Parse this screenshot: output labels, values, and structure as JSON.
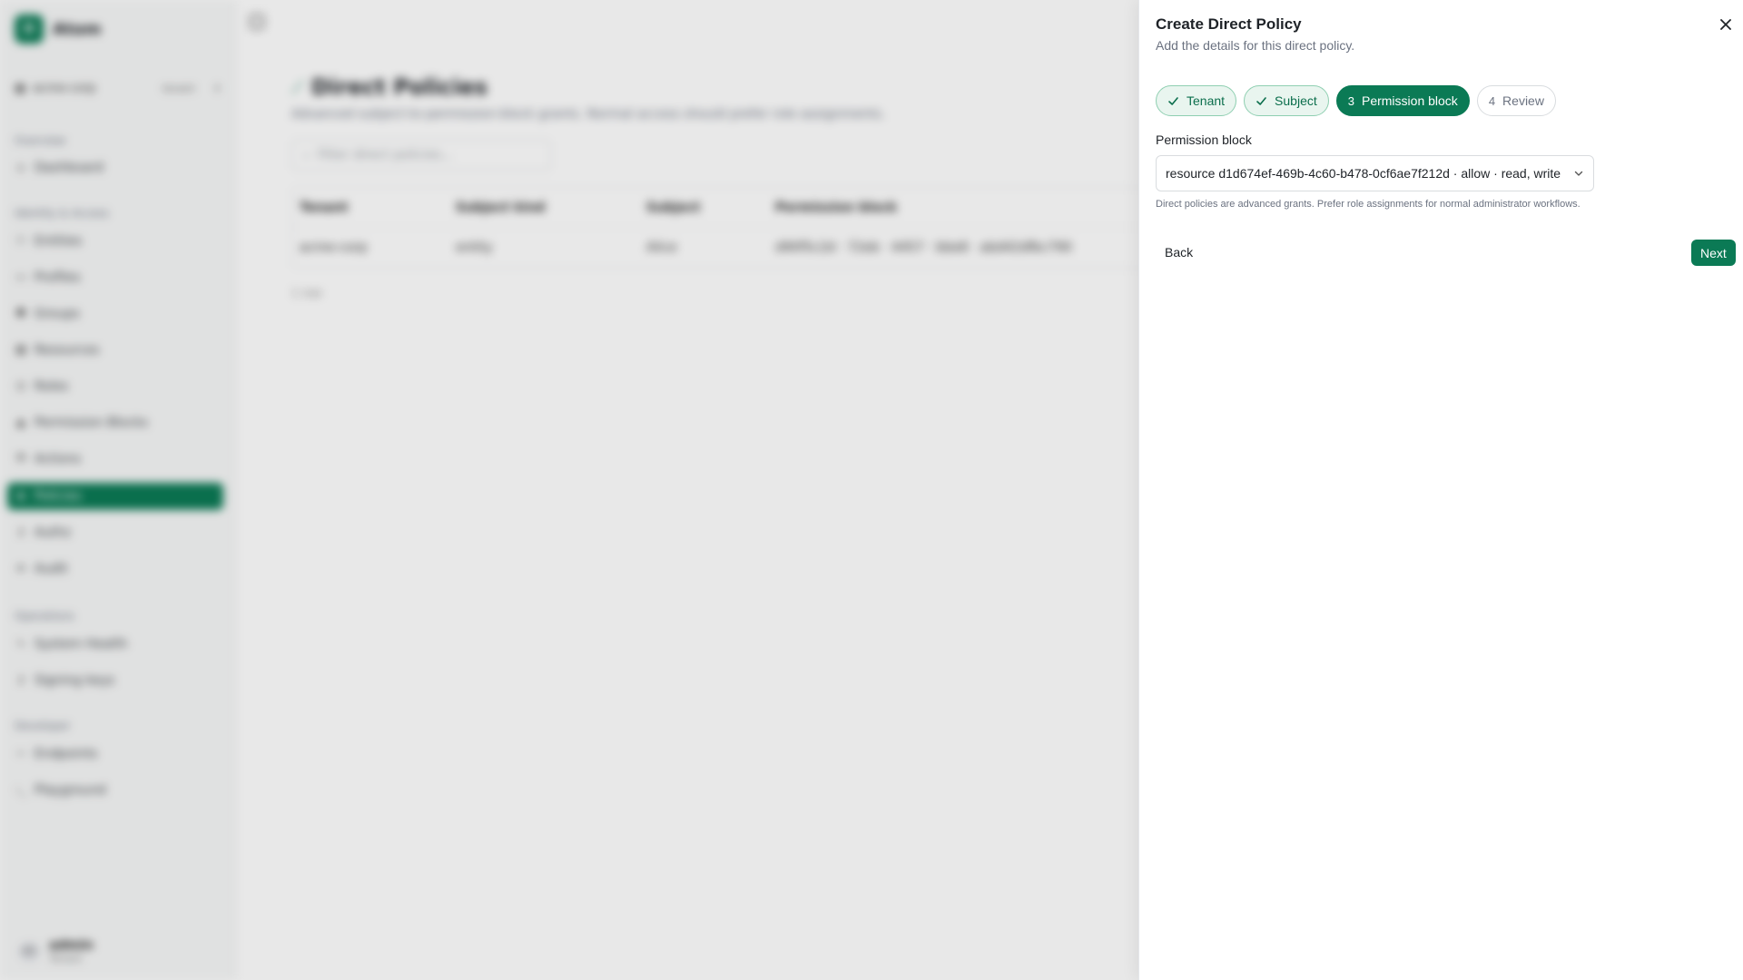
{
  "app": {
    "brand": {
      "logo_letter": "D",
      "name": "Atom"
    },
    "tenant": {
      "name": "acme-corp",
      "badge": "tenant",
      "icon": "building-icon"
    },
    "sections": {
      "overview": "Overview",
      "identity": "Identity & Access",
      "operations": "Operations",
      "developer": "Developer"
    },
    "nav": {
      "dashboard": "Dashboard",
      "entities": "Entities",
      "profiles": "Profiles",
      "groups": "Groups",
      "resources": "Resources",
      "roles": "Roles",
      "permission_blocks": "Permission Blocks",
      "actions": "Actions",
      "policies": "Policies",
      "authz": "Authz",
      "audit": "Audit",
      "system_health": "System Health",
      "signing_keys": "Signing keys",
      "endpoints": "Endpoints",
      "playground": "Playground"
    },
    "user": {
      "initials": "AD",
      "name": "admin",
      "role": "Tenant"
    },
    "page": {
      "title": "Direct Policies",
      "subtitle": "Advanced subject-to-permission-block grants. Normal access should prefer role assignments.",
      "filter_placeholder": "Filter direct policies...",
      "table": {
        "headers": [
          "Tenant",
          "Subject kind",
          "Subject",
          "Permission block"
        ],
        "rows": [
          [
            "acme-corp",
            "entity",
            "Alice",
            "d90f5c2d · 72eb · 4457 · bbe8 · abd42dfbc790"
          ]
        ]
      },
      "row_count": "1 row"
    }
  },
  "drawer": {
    "title": "Create Direct Policy",
    "subtitle": "Add the details for this direct policy.",
    "steps": [
      {
        "label": "Tenant",
        "state": "done"
      },
      {
        "label": "Subject",
        "state": "done"
      },
      {
        "num": "3",
        "label": "Permission block",
        "state": "current"
      },
      {
        "num": "4",
        "label": "Review",
        "state": "todo"
      }
    ],
    "field_label": "Permission block",
    "select_value": "resource d1d674ef-469b-4c60-b478-0cf6ae7f212d · allow · read, write",
    "help_text": "Direct policies are advanced grants. Prefer role assignments for normal administrator workflows.",
    "back_label": "Back",
    "next_label": "Next"
  },
  "colors": {
    "accent": "#0b7a55",
    "step_done_bg": "#e9f5ef",
    "step_done_border": "#8fcfb1"
  }
}
